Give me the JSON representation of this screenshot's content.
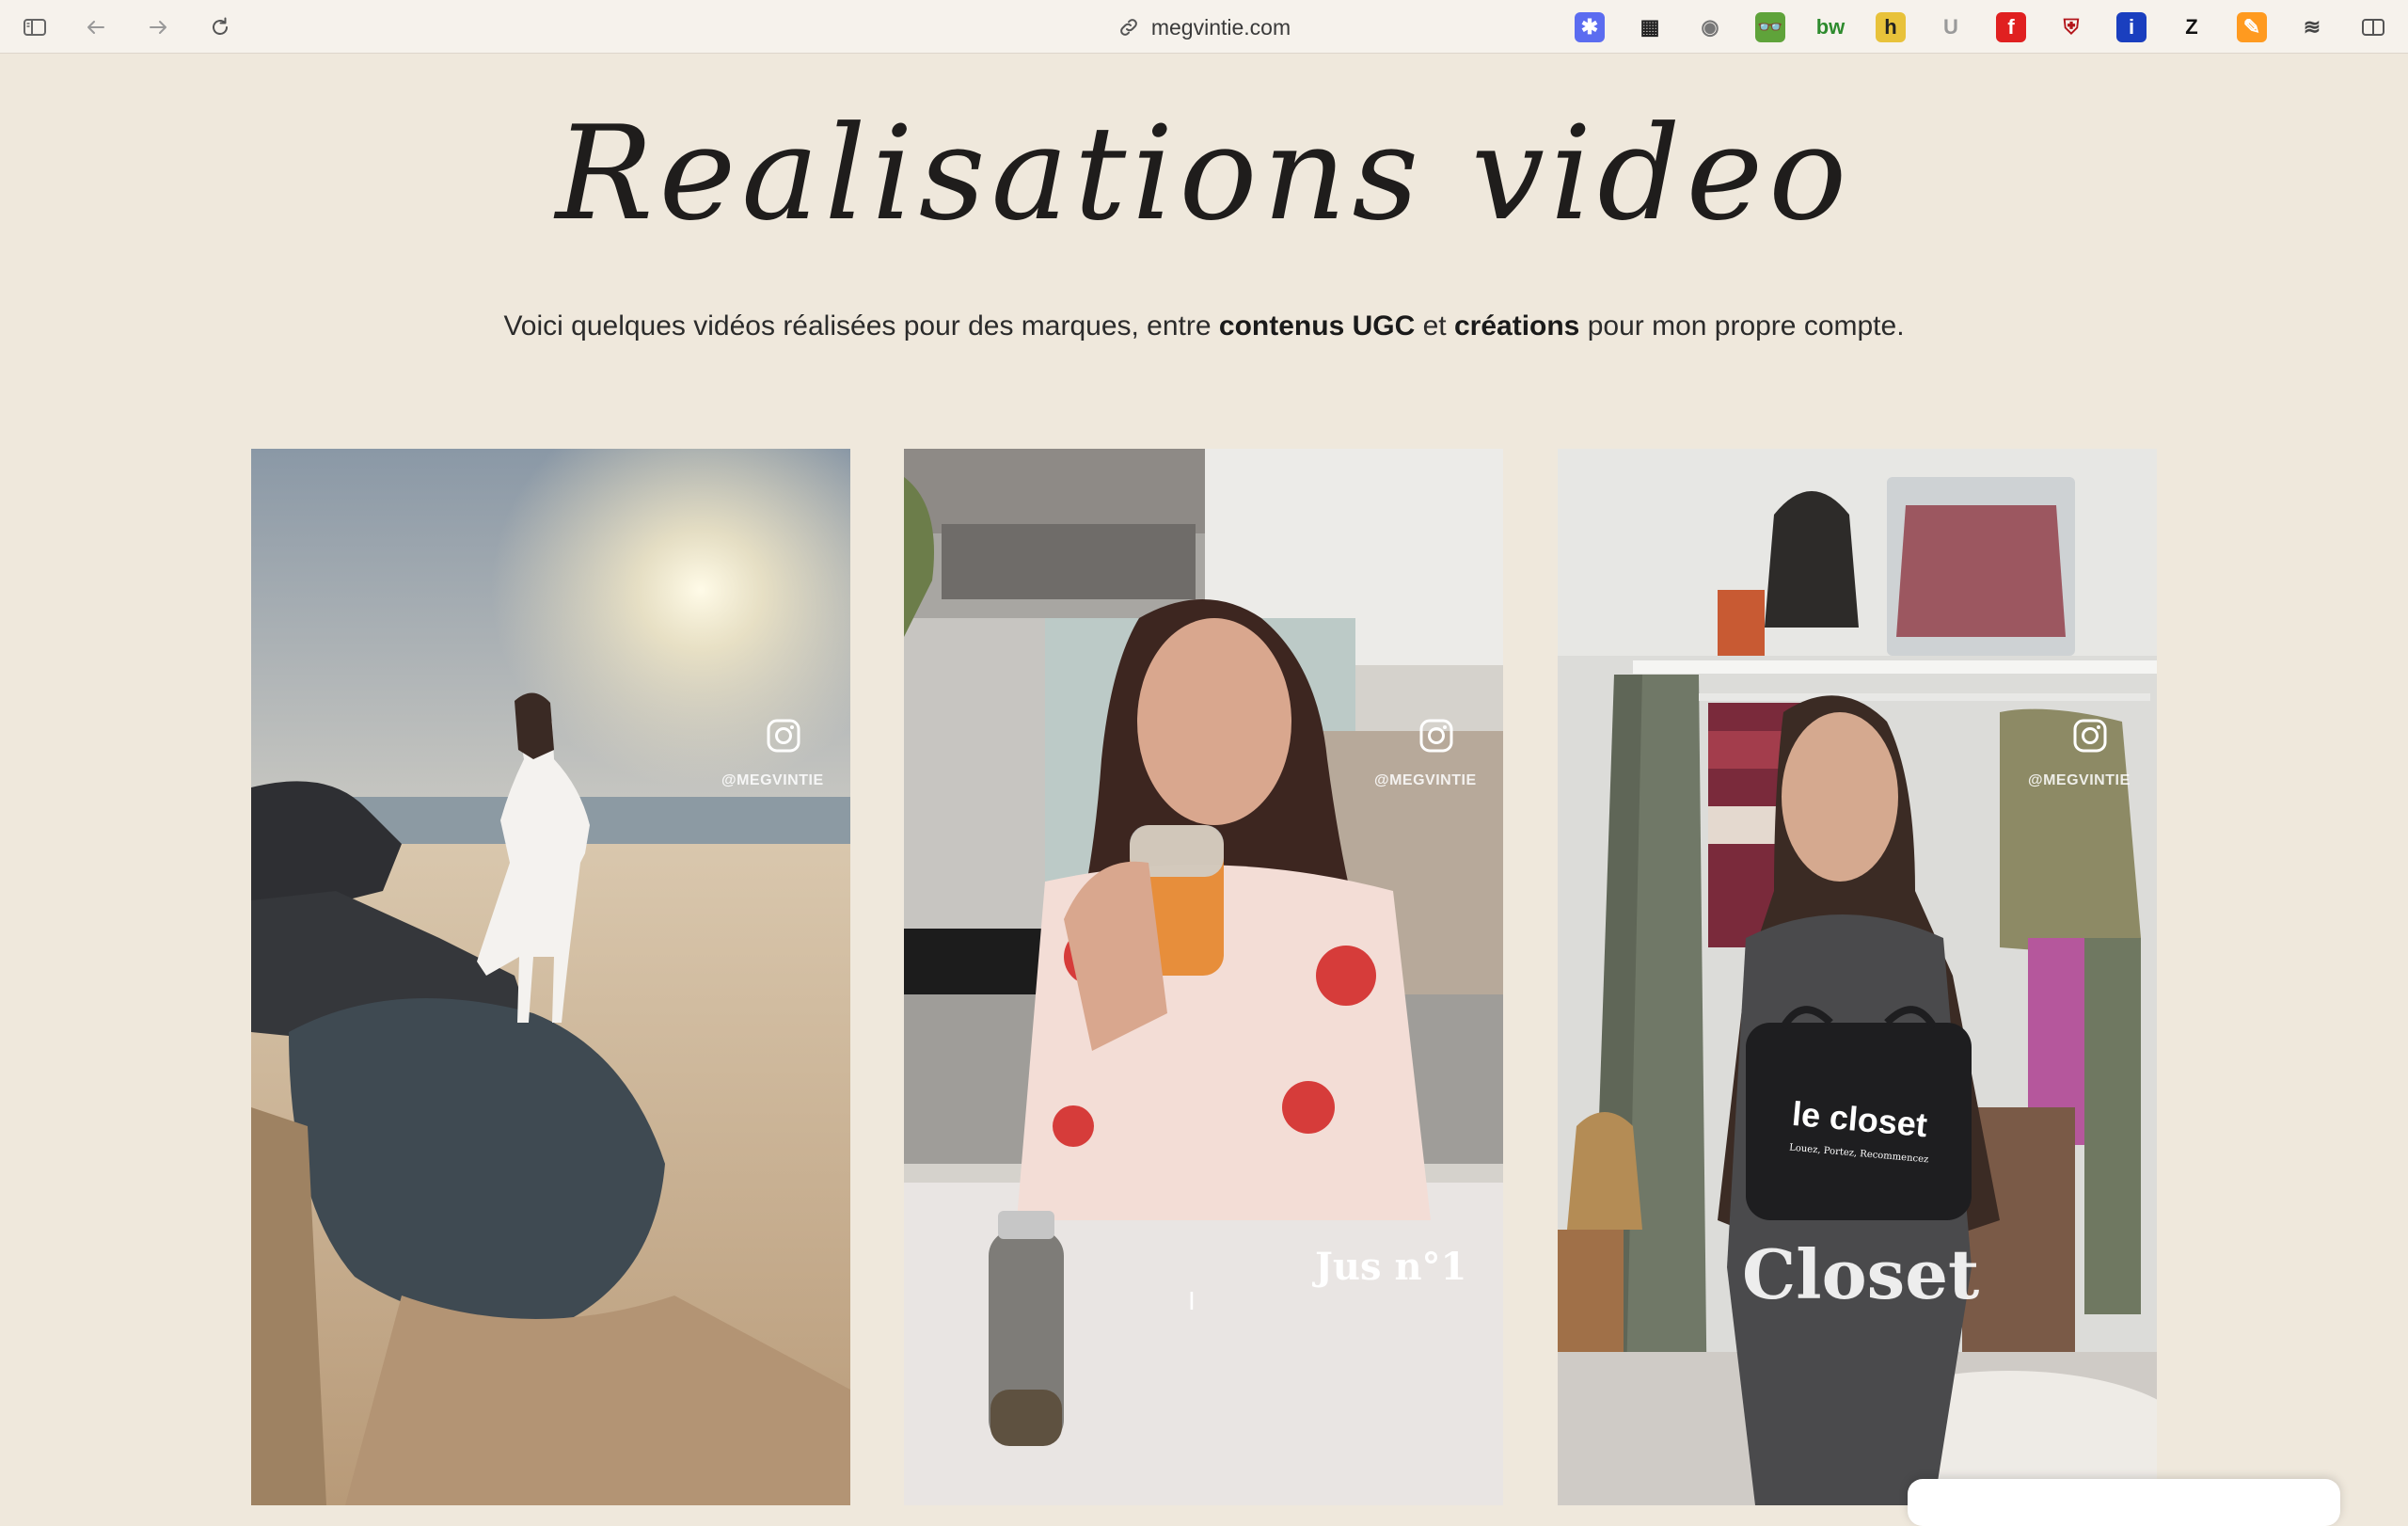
{
  "browser": {
    "url": "megvintie.com",
    "extensions": [
      {
        "name": "ext-1",
        "glyph": "✱",
        "color": "#5b6cf0",
        "fg": "#ffffff"
      },
      {
        "name": "ext-2",
        "glyph": "▦",
        "color": "transparent",
        "fg": "#222222"
      },
      {
        "name": "ext-3",
        "glyph": "◉",
        "color": "transparent",
        "fg": "#777777"
      },
      {
        "name": "ext-4",
        "glyph": "👓",
        "color": "#5fa33a",
        "fg": "#ffffff"
      },
      {
        "name": "ext-5",
        "glyph": "bw",
        "color": "transparent",
        "fg": "#2e8b2e"
      },
      {
        "name": "ext-6",
        "glyph": "h",
        "color": "#e8c23a",
        "fg": "#222222"
      },
      {
        "name": "ext-7",
        "glyph": "U",
        "color": "transparent",
        "fg": "#9a9a9a"
      },
      {
        "name": "ext-8",
        "glyph": "f",
        "color": "#e02020",
        "fg": "#ffffff"
      },
      {
        "name": "ext-9",
        "glyph": "⛨",
        "color": "transparent",
        "fg": "#b3151a"
      },
      {
        "name": "ext-10",
        "glyph": "i",
        "color": "#1a3fbf",
        "fg": "#ffffff"
      },
      {
        "name": "ext-11",
        "glyph": "Z",
        "color": "transparent",
        "fg": "#111111"
      },
      {
        "name": "ext-12",
        "glyph": "✎",
        "color": "#ff9a1f",
        "fg": "#ffffff"
      },
      {
        "name": "ext-13",
        "glyph": "≋",
        "color": "transparent",
        "fg": "#444444"
      }
    ]
  },
  "page": {
    "title": "Realisations video",
    "subtitle_prefix": "Voici quelques vidéos réalisées pour des marques, entre ",
    "subtitle_bold1": "contenus UGC",
    "subtitle_mid": " et ",
    "subtitle_bold2": "créations",
    "subtitle_suffix": " pour mon propre compte."
  },
  "videos": [
    {
      "handle": "@MEGVINTIE",
      "overlay": ""
    },
    {
      "handle": "@MEGVINTIE",
      "overlay": "Jus n°1"
    },
    {
      "handle": "@MEGVINTIE",
      "overlay": "Closet",
      "bag_text": "le closet",
      "bag_sub": "Louez, Portez, Recommencez"
    }
  ]
}
